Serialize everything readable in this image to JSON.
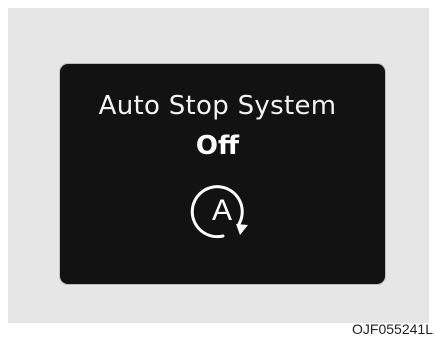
{
  "display": {
    "title": "Auto Stop System",
    "status": "Off",
    "icon": "auto-stop-off-icon",
    "icon_letter": "A"
  },
  "caption": "OJF055241L",
  "colors": {
    "background": "#e6e6e6",
    "display": "#121212",
    "text": "#ffffff"
  }
}
